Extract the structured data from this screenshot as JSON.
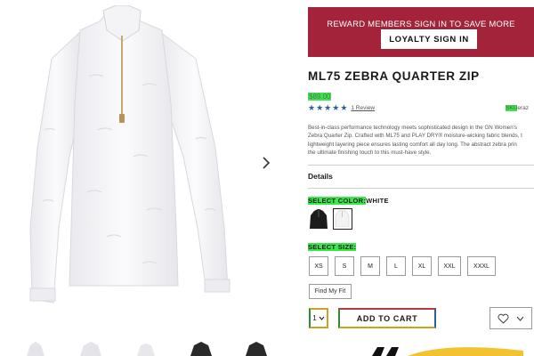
{
  "banner": {
    "text": "REWARD MEMBERS SIGN IN TO SAVE MORE",
    "button_label": "LOYALTY SIGN IN",
    "color": "#a3233b"
  },
  "product": {
    "title": "ML75 ZEBRA QUARTER ZIP",
    "price": "$89.00",
    "rating": 5,
    "rating_max": 5,
    "review_link": "1 Review",
    "sku_prefix": "SKU",
    "sku_value": "eraz",
    "description_lines": [
      "Best-in-class performance technology meets sophisticated design in the GN Women's",
      "Zebra Quarter Zip. Crafted with ML75 and PLAY DRY® moisture-wicking fabric blends, t",
      "lightweight layering piece ensures lasting comfort all day long. The abstract zebra prin",
      "the ultimate finishing touch to this must-have style."
    ]
  },
  "details": {
    "heading": "Details"
  },
  "color_select": {
    "label": "SELECT COLOR:",
    "selected_value": "WHITE",
    "swatches": [
      {
        "name": "black",
        "color": "#1c1c1c"
      },
      {
        "name": "white",
        "color": "#f3f3f5"
      }
    ]
  },
  "size_select": {
    "label": "SELECT SIZE:",
    "sizes": [
      "XS",
      "S",
      "M",
      "L",
      "XL",
      "XXL",
      "XXXL"
    ]
  },
  "fit": {
    "label": "Find My Fit"
  },
  "cart": {
    "quantity": "1",
    "add_label": "ADD TO CART"
  },
  "icons": {
    "next": "chevron-right-icon",
    "wishlist": "heart-icon",
    "menu": "chevron-down-icon",
    "star": "star-icon"
  },
  "highlight_color": "#39e84a"
}
